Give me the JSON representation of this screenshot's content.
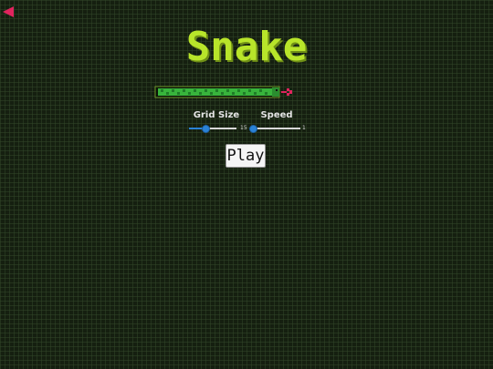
{
  "game": {
    "title": "Snake"
  },
  "icons": {
    "back": "back-arrow-icon",
    "snake": "snake-icon"
  },
  "colors": {
    "background": "#151f10",
    "title": "#b8e52a",
    "snake_body": "#38b43c",
    "snake_tongue": "#e0245e",
    "slider_accent": "#2a82d6"
  },
  "controls": {
    "grid_size": {
      "label": "Grid Size",
      "value": "15",
      "fraction": 0.35
    },
    "speed": {
      "label": "Speed",
      "value": "1",
      "fraction": 0.0
    }
  },
  "buttons": {
    "play_label": "Play"
  }
}
